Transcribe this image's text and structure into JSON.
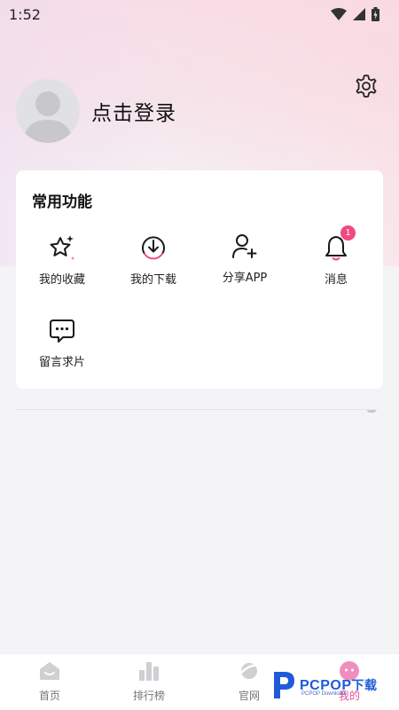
{
  "status_bar": {
    "time": "1:52"
  },
  "profile": {
    "login_text": "点击登录"
  },
  "common_functions": {
    "title": "常用功能",
    "items": [
      {
        "label": "我的收藏",
        "icon": "star-sparkle-icon"
      },
      {
        "label": "我的下载",
        "icon": "download-icon"
      },
      {
        "label": "分享APP",
        "icon": "user-add-icon"
      },
      {
        "label": "消息",
        "icon": "bell-icon",
        "badge": "1"
      },
      {
        "label": "留言求片",
        "icon": "chat-dots-icon"
      }
    ]
  },
  "tabbar": {
    "tabs": [
      {
        "label": "首页",
        "icon": "home-icon"
      },
      {
        "label": "排行榜",
        "icon": "ranking-icon"
      },
      {
        "label": "官网",
        "icon": "planet-icon"
      },
      {
        "label": "我的",
        "icon": "mine-icon",
        "active": true
      }
    ]
  },
  "watermark": {
    "brand": "PCPOP",
    "suffix": "下载",
    "sub": "PCPOP Download"
  },
  "colors": {
    "accent": "#f0487f",
    "active_tab": "#e84f9a",
    "watermark": "#1f5bd9"
  }
}
